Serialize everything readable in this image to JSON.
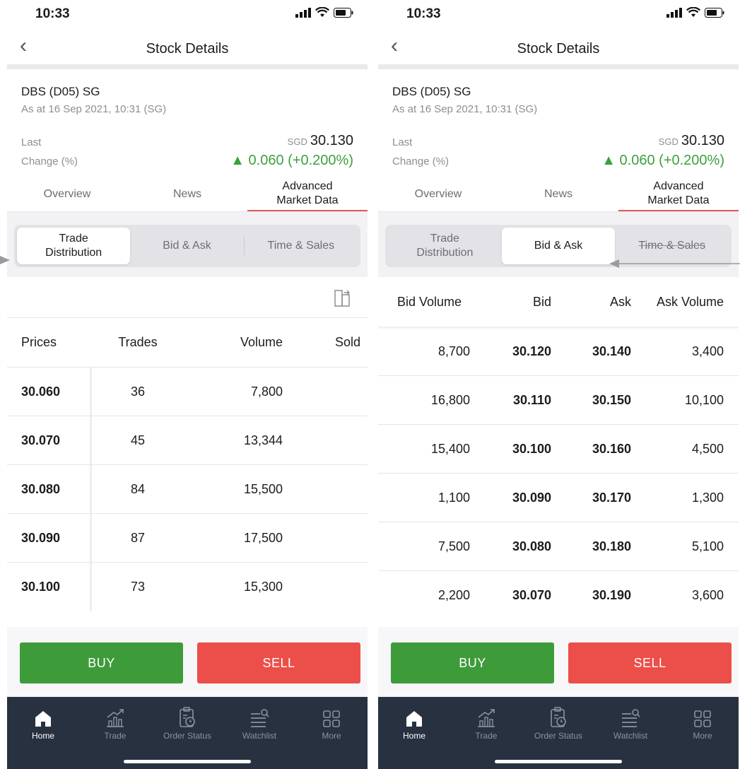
{
  "status": {
    "time": "10:33"
  },
  "nav": {
    "title": "Stock Details"
  },
  "stock": {
    "name": "DBS (D05) SG",
    "as_at": "As at 16 Sep 2021, 10:31 (SG)",
    "last_label": "Last",
    "change_label": "Change (%)",
    "currency": "SGD",
    "price": "30.130",
    "change": "▲ 0.060 (+0.200%)",
    "change_color": "#3aa13c"
  },
  "tabs": [
    "Overview",
    "News",
    "Advanced Market Data"
  ],
  "segments": [
    "Trade Distribution",
    "Bid & Ask",
    "Time & Sales"
  ],
  "trade_distribution": {
    "headers": [
      "Prices",
      "Trades",
      "Volume",
      "Sold"
    ],
    "rows": [
      {
        "price": "30.060",
        "trades": "36",
        "volume": "7,800"
      },
      {
        "price": "30.070",
        "trades": "45",
        "volume": "13,344"
      },
      {
        "price": "30.080",
        "trades": "84",
        "volume": "15,500"
      },
      {
        "price": "30.090",
        "trades": "87",
        "volume": "17,500"
      },
      {
        "price": "30.100",
        "trades": "73",
        "volume": "15,300"
      }
    ]
  },
  "bid_ask": {
    "headers": [
      "Bid Volume",
      "Bid",
      "Ask",
      "Ask Volume"
    ],
    "rows": [
      {
        "bid_volume": "8,700",
        "bid": "30.120",
        "ask": "30.140",
        "ask_volume": "3,400"
      },
      {
        "bid_volume": "16,800",
        "bid": "30.110",
        "ask": "30.150",
        "ask_volume": "10,100"
      },
      {
        "bid_volume": "15,400",
        "bid": "30.100",
        "ask": "30.160",
        "ask_volume": "4,500"
      },
      {
        "bid_volume": "1,100",
        "bid": "30.090",
        "ask": "30.170",
        "ask_volume": "1,300"
      },
      {
        "bid_volume": "7,500",
        "bid": "30.080",
        "ask": "30.180",
        "ask_volume": "5,100"
      },
      {
        "bid_volume": "2,200",
        "bid": "30.070",
        "ask": "30.190",
        "ask_volume": "3,600"
      }
    ]
  },
  "actions": {
    "buy": "BUY",
    "sell": "SELL",
    "buy_color": "#3e9b3a",
    "sell_color": "#ec4f49"
  },
  "bottom_nav": [
    {
      "label": "Home",
      "icon": "home-icon"
    },
    {
      "label": "Trade",
      "icon": "chart-up-icon"
    },
    {
      "label": "Order Status",
      "icon": "clipboard-clock-icon"
    },
    {
      "label": "Watchlist",
      "icon": "list-search-icon"
    },
    {
      "label": "More",
      "icon": "grid-icon"
    }
  ]
}
